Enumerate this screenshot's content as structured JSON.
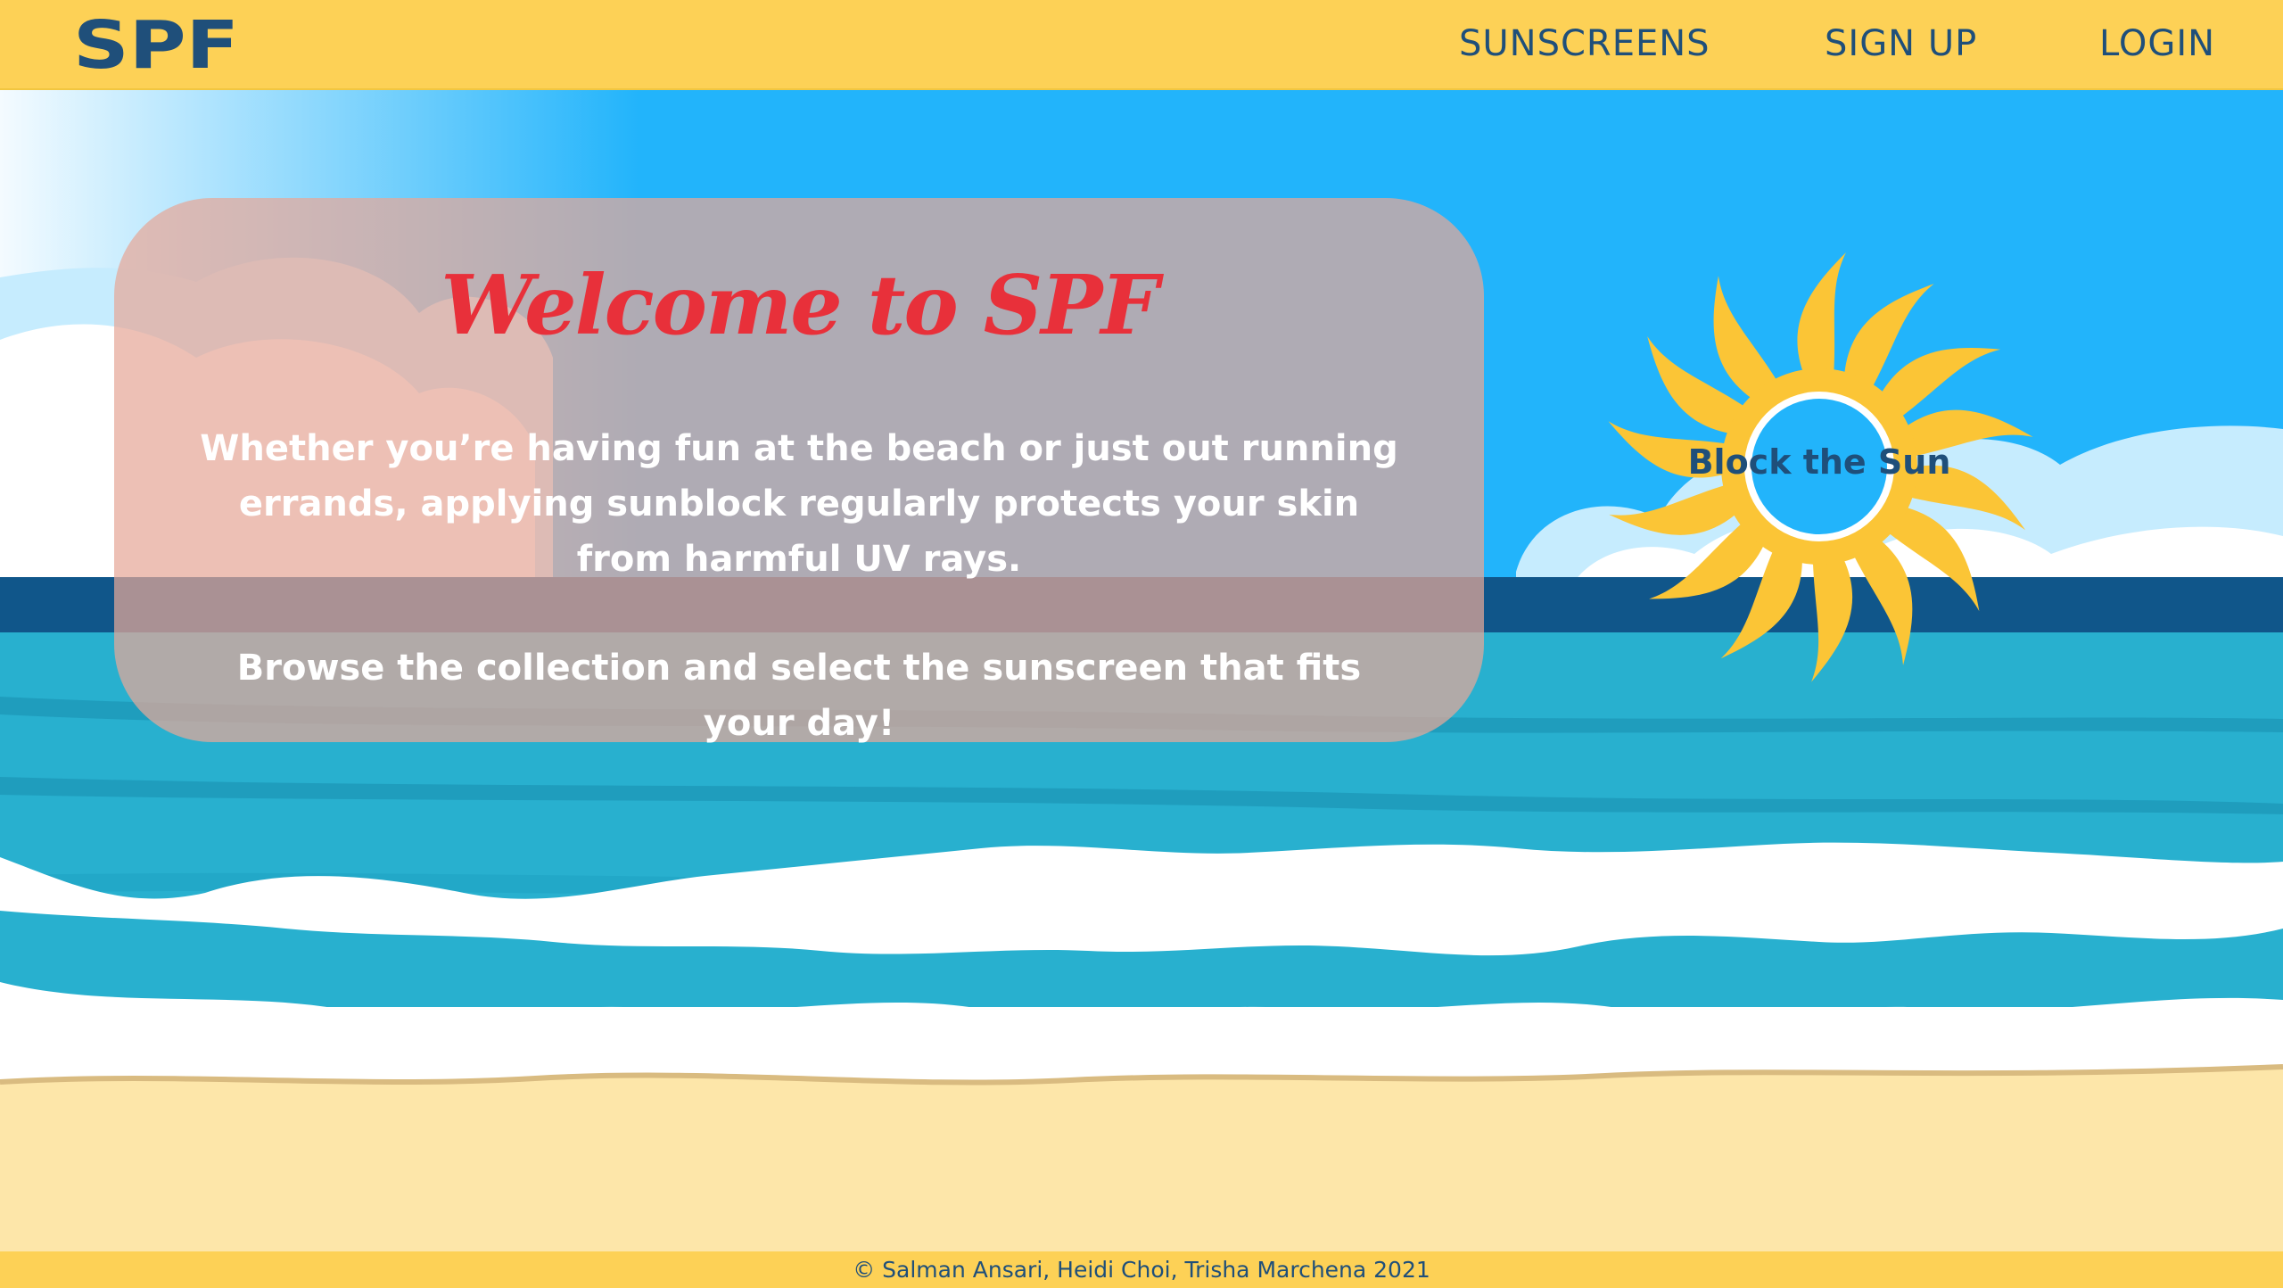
{
  "brand": {
    "logo_text": "SPF"
  },
  "nav": {
    "sunscreens": "SUNSCREENS",
    "signup": "SIGN UP",
    "login": "LOGIN"
  },
  "hero": {
    "title": "Welcome to SPF",
    "body": "Whether you’re having fun at the beach or just out running errands, applying sunblock regularly protects your skin from harmful UV rays.",
    "cta_text": "Browse the collection and select the sunscreen that fits your day!",
    "sun_button": "Block the Sun"
  },
  "footer": {
    "copyright": "© Salman Ansari, Heidi Choi, Trisha Marchena 2021"
  },
  "colors": {
    "nav_bg": "#fdd156",
    "nav_text": "#1f4f7a",
    "sky": "#22b4fb",
    "sea": "#28b0cf",
    "sand": "#fde6a9",
    "title": "#e8303a",
    "sun": "#fbc536"
  },
  "icons": {
    "logo": "spf-logo",
    "sun": "sun-icon"
  }
}
